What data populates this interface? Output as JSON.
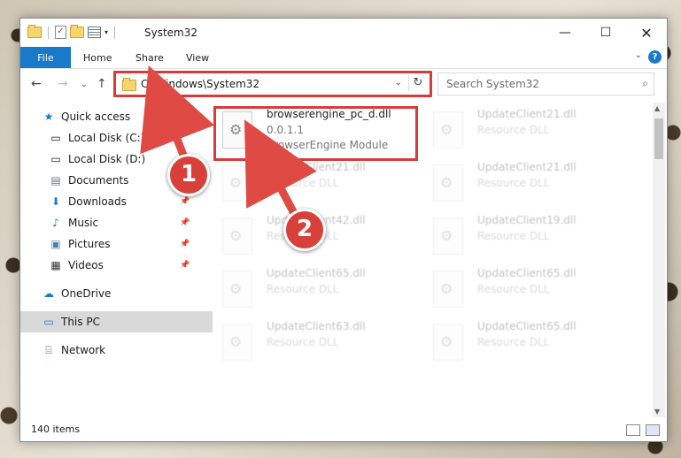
{
  "window": {
    "title": "System32"
  },
  "ribbon": {
    "file": "File",
    "tabs": [
      "Home",
      "Share",
      "View"
    ],
    "help": "?"
  },
  "nav": {
    "address": "C:\\Windows\\System32",
    "search_placeholder": "Search System32"
  },
  "sidebar": {
    "items": [
      {
        "label": "Quick access",
        "icon": "star-icon"
      },
      {
        "label": "Local Disk (C:)",
        "icon": "drive-icon"
      },
      {
        "label": "Local Disk (D:)",
        "icon": "drive-icon"
      },
      {
        "label": "Documents",
        "icon": "documents-icon"
      },
      {
        "label": "Downloads",
        "icon": "downloads-icon"
      },
      {
        "label": "Music",
        "icon": "music-icon"
      },
      {
        "label": "Pictures",
        "icon": "pictures-icon"
      },
      {
        "label": "Videos",
        "icon": "videos-icon"
      },
      {
        "label": "OneDrive",
        "icon": "cloud-icon"
      },
      {
        "label": "This PC",
        "icon": "computer-icon"
      },
      {
        "label": "Network",
        "icon": "network-icon"
      }
    ]
  },
  "files": {
    "highlighted": {
      "name": "browserengine_pc_d.dll",
      "version": "0.0.1.1",
      "desc": "BrowserEngine Module"
    },
    "blurred": [
      {
        "name": "UpdateClient21.dll",
        "desc": "Resource DLL"
      },
      {
        "name": "UpdateClient21.dll",
        "desc": "Resource DLL"
      },
      {
        "name": "UpdateClient21.dll",
        "desc": "Resource DLL"
      },
      {
        "name": "UpdateClient42.dll",
        "desc": "Resource DLL"
      },
      {
        "name": "UpdateClient19.dll",
        "desc": "Resource DLL"
      },
      {
        "name": "UpdateClient65.dll",
        "desc": "Resource DLL"
      },
      {
        "name": "UpdateClient65.dll",
        "desc": "Resource DLL"
      },
      {
        "name": "UpdateClient63.dll",
        "desc": "Resource DLL"
      },
      {
        "name": "UpdateClient65.dll",
        "desc": "Resource DLL"
      }
    ]
  },
  "status": {
    "count": "140 items"
  },
  "steps": {
    "one": "1",
    "two": "2"
  },
  "colors": {
    "accent": "#1979ca",
    "highlight": "#d83b3b",
    "badge": "#d8403a"
  }
}
